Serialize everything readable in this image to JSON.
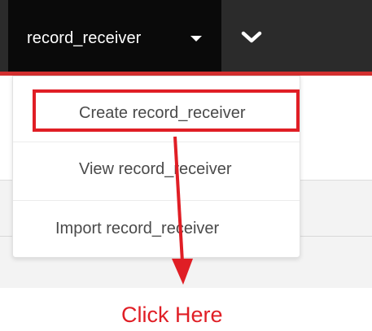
{
  "navbar": {
    "main_label": "record_receiver"
  },
  "dropdown": {
    "items": [
      {
        "label": "Create record_receiver"
      },
      {
        "label": "View record_receiver"
      },
      {
        "label": "Import record_receiver"
      }
    ]
  },
  "annotation": {
    "text": "Click Here",
    "color": "#e01e25"
  },
  "colors": {
    "navbar_bg": "#2b2b2b",
    "navbar_active_bg": "#0a0a0a",
    "accent_bar": "#d32f2f"
  },
  "icons": {
    "caret": "caret-down-icon",
    "chevron": "chevron-down-icon",
    "arrow": "arrow-down-icon"
  }
}
